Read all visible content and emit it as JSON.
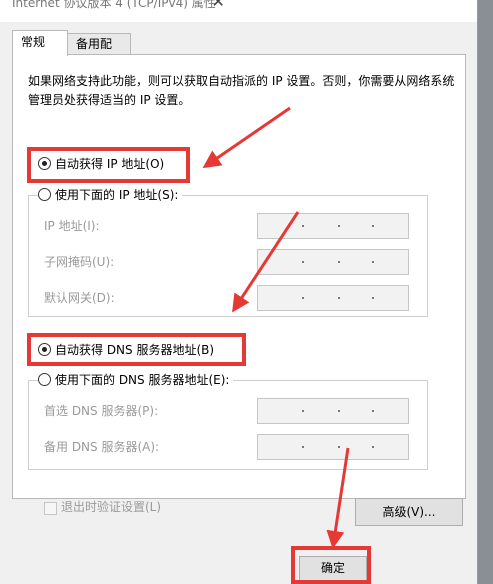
{
  "window": {
    "title": "Internet 协议版本 4 (TCP/IPv4) 属性",
    "close_glyph": "✕"
  },
  "tabs": [
    {
      "label": "常规"
    },
    {
      "label": "备用配置"
    }
  ],
  "description": "如果网络支持此功能，则可以获取自动指派的 IP 设置。否则，你需要从网络系统管理员处获得适当的 IP 设置。",
  "ip": {
    "auto_label": "自动获得 IP 地址(O)",
    "auto_selected": true,
    "manual_label": "使用下面的 IP 地址(S):",
    "fields": [
      {
        "label": "IP 地址(I):"
      },
      {
        "label": "子网掩码(U):"
      },
      {
        "label": "默认网关(D):"
      }
    ]
  },
  "dns": {
    "auto_label": "自动获得 DNS 服务器地址(B)",
    "auto_selected": true,
    "manual_label": "使用下面的 DNS 服务器地址(E):",
    "fields": [
      {
        "label": "首选 DNS 服务器(P):"
      },
      {
        "label": "备用 DNS 服务器(A):"
      }
    ]
  },
  "validate_label": "退出时验证设置(L)",
  "advanced_label": "高级(V)...",
  "ok_label": "确定",
  "colors": {
    "highlight": "#e53935",
    "disabled_text": "#9a9a9a"
  }
}
